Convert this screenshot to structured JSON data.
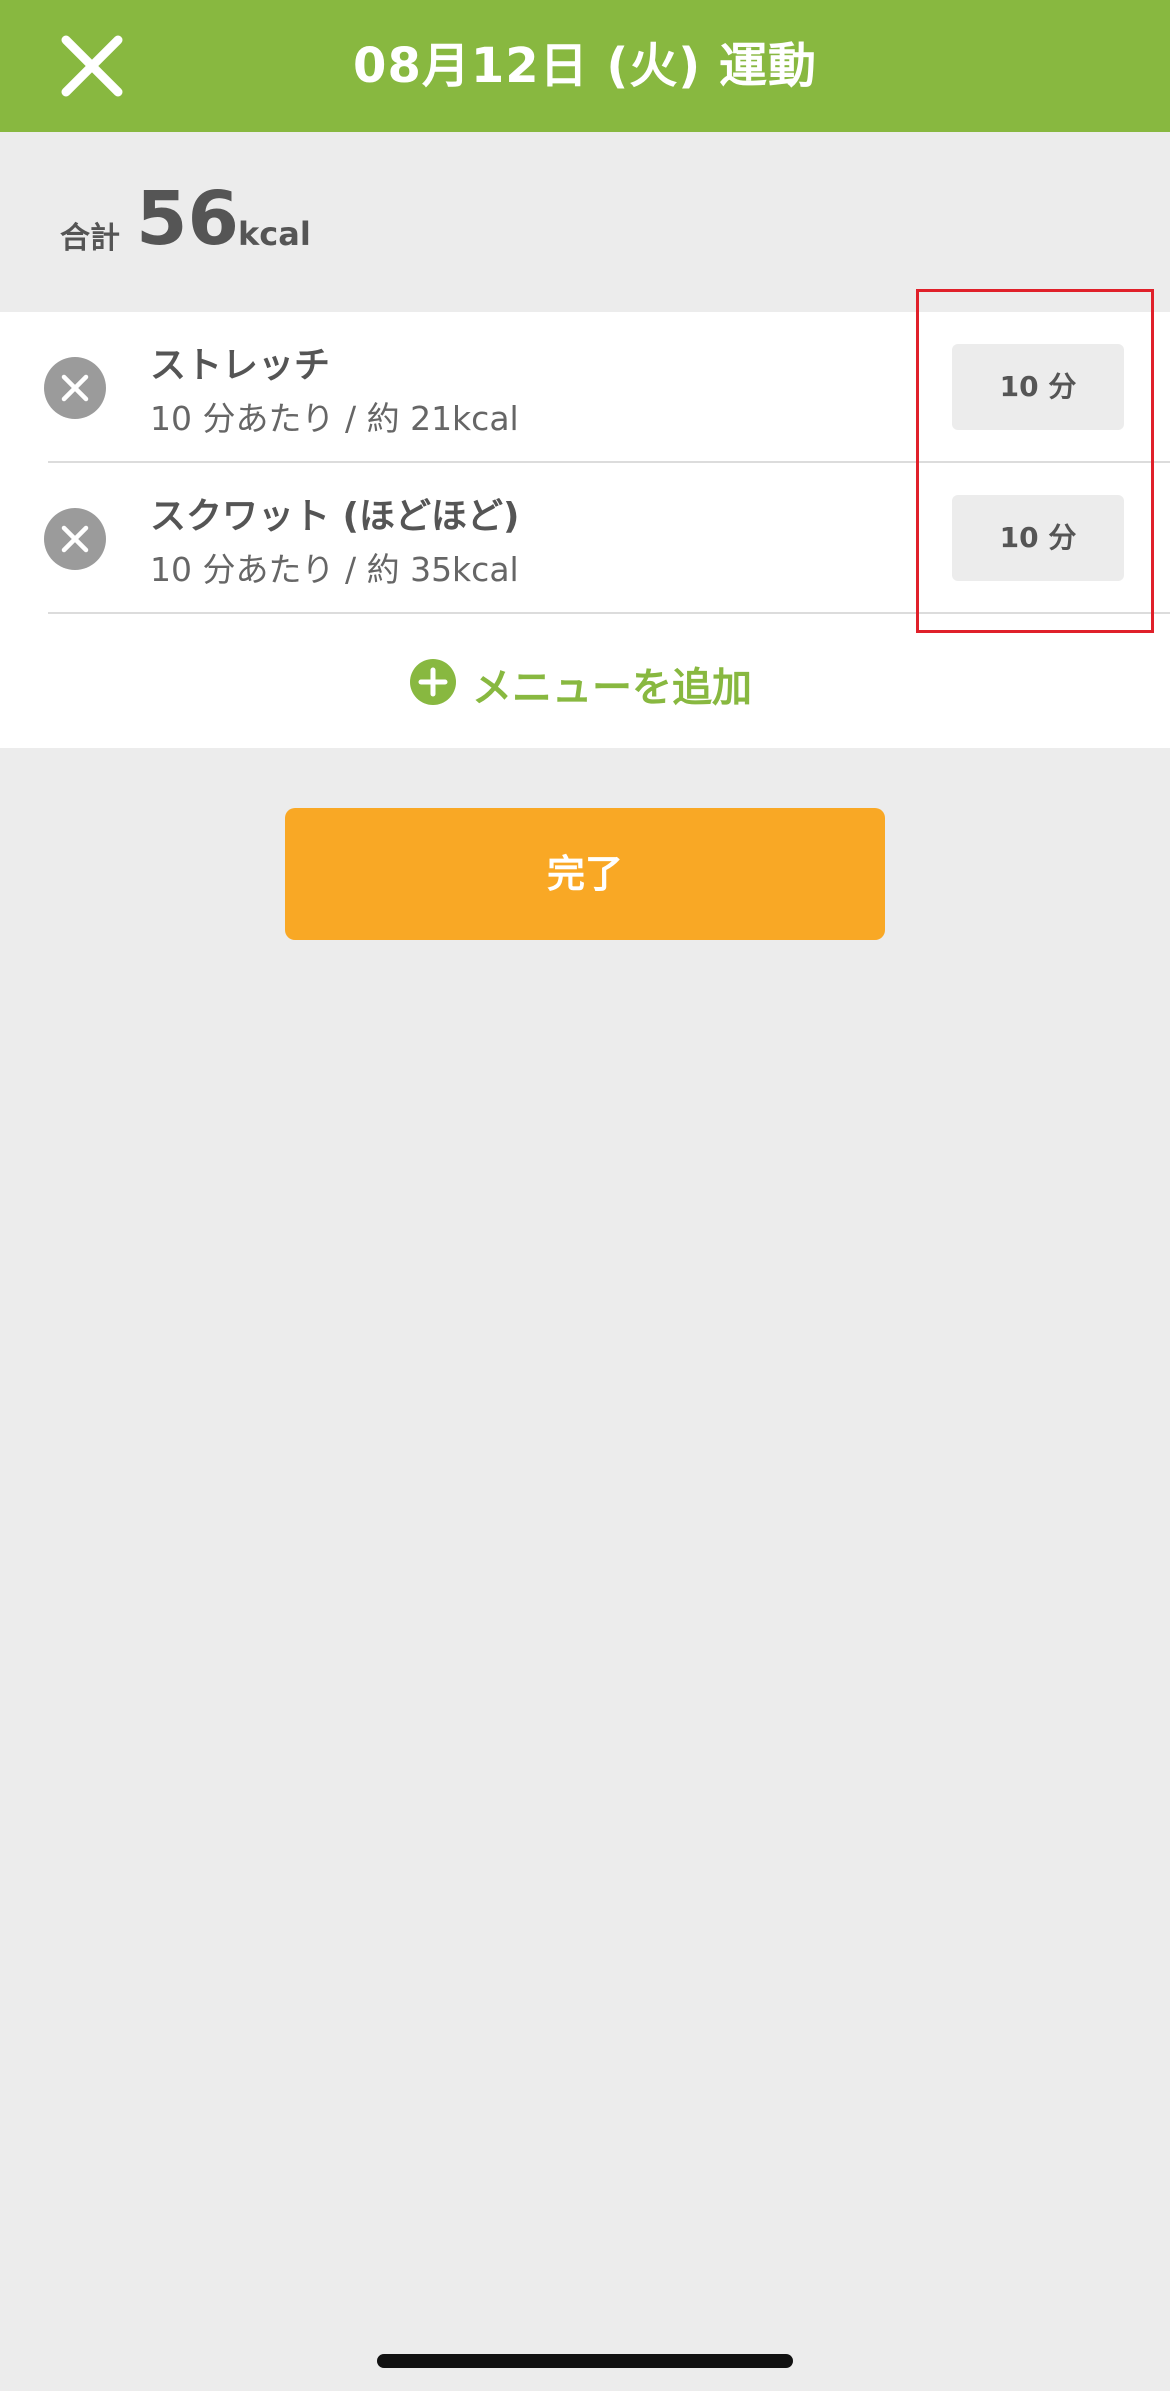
{
  "header": {
    "title": "08月12日 (火) 運動",
    "close_icon": "close-icon",
    "bg_color": "#88b840"
  },
  "summary": {
    "label": "合計",
    "value": "56",
    "unit": "kcal"
  },
  "exercises": [
    {
      "title": "ストレッチ",
      "subtitle": "10 分あたり / 約 21kcal",
      "duration": "10 分"
    },
    {
      "title": "スクワット (ほどほど)",
      "subtitle": "10 分あたり / 約 35kcal",
      "duration": "10 分"
    }
  ],
  "add_menu": {
    "label": "メニューを追加",
    "icon": "plus-circle-icon"
  },
  "done_button": {
    "label": "完了",
    "color": "#f9a825"
  },
  "colors": {
    "accent": "#88b840",
    "highlight": "#e0202a"
  }
}
